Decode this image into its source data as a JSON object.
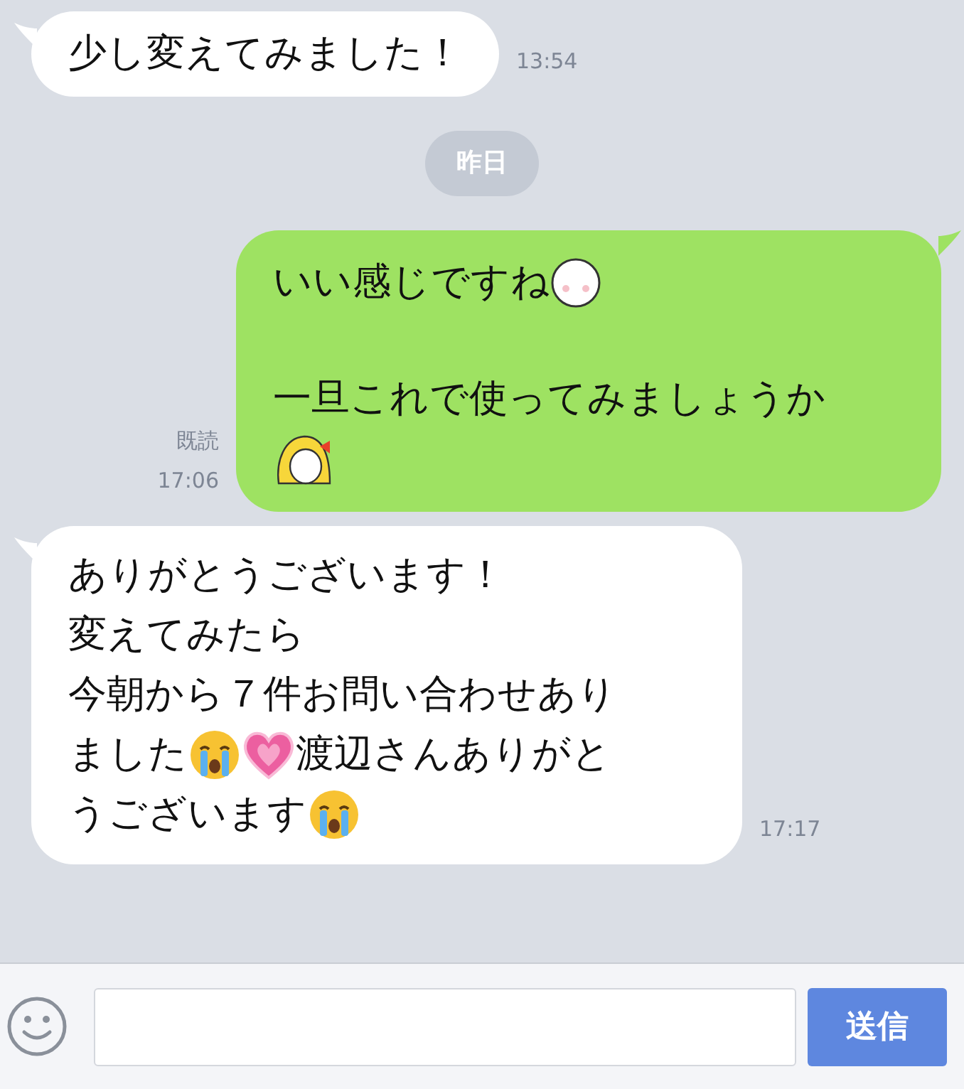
{
  "messages": [
    {
      "kind": "received",
      "paragraphs": [
        {
          "lines": [
            [
              {
                "kind": "text",
                "text": "少し変えてみました！"
              }
            ]
          ]
        }
      ],
      "time": "13:54"
    },
    {
      "kind": "date",
      "label": "昨日"
    },
    {
      "kind": "sent",
      "paragraphs": [
        {
          "lines": [
            [
              {
                "kind": "text",
                "text": "いい感じですね"
              },
              {
                "kind": "moon"
              }
            ]
          ]
        },
        {
          "lines": [
            [
              {
                "kind": "text",
                "text": "一旦これで使ってみましょうか"
              }
            ],
            [
              {
                "kind": "girl"
              }
            ]
          ]
        }
      ],
      "read_label": "既読",
      "time": "17:06"
    },
    {
      "kind": "received",
      "paragraphs": [
        {
          "lines": [
            [
              {
                "kind": "text",
                "text": "ありがとうございます！"
              }
            ],
            [
              {
                "kind": "text",
                "text": "変えてみたら"
              }
            ],
            [
              {
                "kind": "text",
                "text": "今朝から７件お問い合わせあり"
              }
            ],
            [
              {
                "kind": "text",
                "text": "ました"
              },
              {
                "kind": "crying"
              },
              {
                "kind": "heart"
              },
              {
                "kind": "text",
                "text": "渡辺さんありがと"
              }
            ],
            [
              {
                "kind": "text",
                "text": "うございます"
              },
              {
                "kind": "crying"
              }
            ]
          ]
        }
      ],
      "time": "17:17"
    }
  ],
  "composer": {
    "send_label": "送信"
  }
}
